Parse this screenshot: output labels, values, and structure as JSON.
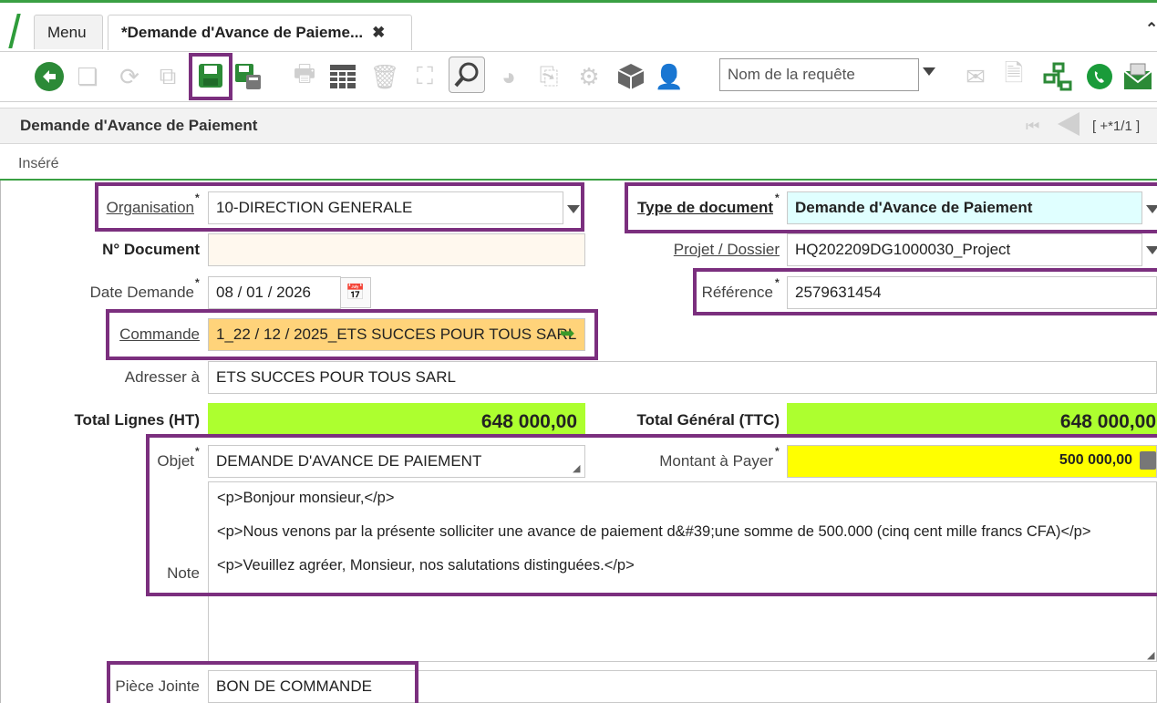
{
  "tabs": [
    {
      "label": "Menu"
    },
    {
      "label": "*Demande d'Avance de Paieme...",
      "close": "✖"
    }
  ],
  "toolbar": {
    "request_placeholder": "Nom de la requête",
    "icons": [
      "undo-icon",
      "new-icon",
      "refresh-icon",
      "copy-icon",
      "save-icon",
      "save-new-icon",
      "print-icon",
      "grid-icon",
      "delete-icon",
      "expand-icon",
      "search-icon",
      "chart-icon",
      "attach-icon",
      "settings-icon",
      "package-icon",
      "user-icon",
      "email-icon",
      "document-icon",
      "workflow-icon",
      "whatsapp-icon",
      "mail-icon"
    ]
  },
  "header": {
    "title": "Demande d'Avance de Paiement",
    "nav_count": "[ +*1/1 ]",
    "status": "Inséré"
  },
  "form": {
    "organisation": {
      "label": "Organisation",
      "value": "10-DIRECTION GENERALE"
    },
    "type_document": {
      "label": "Type de document",
      "value": "Demande d'Avance de Paiement"
    },
    "no_document": {
      "label": "N° Document",
      "value": ""
    },
    "projet": {
      "label": "Projet / Dossier",
      "value": "HQ202209DG1000030_Project"
    },
    "date_demande": {
      "label": "Date Demande",
      "value": "08 / 01 / 2026"
    },
    "reference": {
      "label": "Référence",
      "value": "2579631454"
    },
    "commande": {
      "label": "Commande",
      "value": "1_22 / 12 / 2025_ETS SUCCES POUR TOUS SARL"
    },
    "adresser": {
      "label": "Adresser à",
      "value": "ETS SUCCES POUR TOUS SARL"
    },
    "total_lignes": {
      "label": "Total Lignes (HT)",
      "value": "648 000,00"
    },
    "total_general": {
      "label": "Total Général (TTC)",
      "value": "648 000,00"
    },
    "objet": {
      "label": "Objet",
      "value": "DEMANDE D'AVANCE DE PAIEMENT"
    },
    "montant": {
      "label": "Montant à Payer",
      "value": "500 000,00"
    },
    "note": {
      "label": "Note",
      "lines": [
        "<p>Bonjour monsieur,</p>",
        "<p>Nous venons par la présente solliciter une avance de paiement d&#39;une somme de 500.000 (cinq cent mille francs CFA)</p>",
        "<p>Veuillez agréer, Monsieur, nos salutations distinguées.</p>"
      ]
    },
    "piece_jointe": {
      "label": "Pièce Jointe",
      "value": "BON DE COMMANDE"
    },
    "required_mark": "*"
  },
  "colors": {
    "accent_green": "#3aa043",
    "highlight_border": "#7b2f7e",
    "total_bg": "#adff2f",
    "amount_bg": "#ffff00",
    "doc_type_bg": "#e0ffff",
    "commande_bg": "#ffd37a",
    "readonly_bg": "#fff8ee"
  }
}
